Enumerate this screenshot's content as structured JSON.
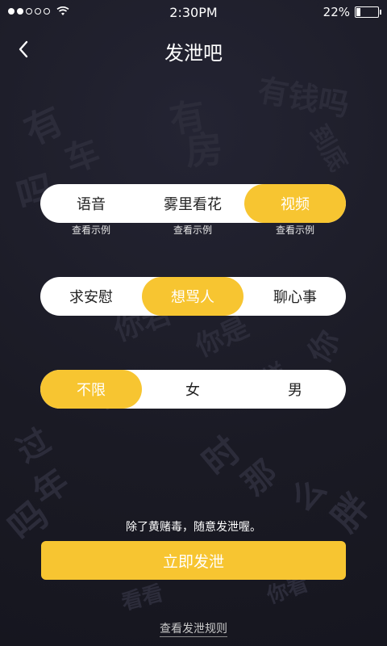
{
  "status_bar": {
    "time": "2:30PM",
    "battery_text": "22%",
    "battery_level": 0.22
  },
  "nav": {
    "title": "发泄吧",
    "back_icon": "chevron-left-icon"
  },
  "mode_selector": {
    "items": [
      "语音",
      "雾里看花",
      "视频"
    ],
    "selected": "视频",
    "example_labels": [
      "查看示例",
      "查看示例",
      "查看示例"
    ]
  },
  "mood_selector": {
    "items": [
      "求安慰",
      "想骂人",
      "聊心事"
    ],
    "selected": "想骂人"
  },
  "gender_selector": {
    "items": [
      "不限",
      "女",
      "男"
    ],
    "selected": "不限"
  },
  "note": "除了黄赌毒，随意发泄喔。",
  "primary_button": "立即发泄",
  "rules_link": "查看发泄规则",
  "colors": {
    "accent": "#f7c531",
    "background": "#1c1c27"
  }
}
